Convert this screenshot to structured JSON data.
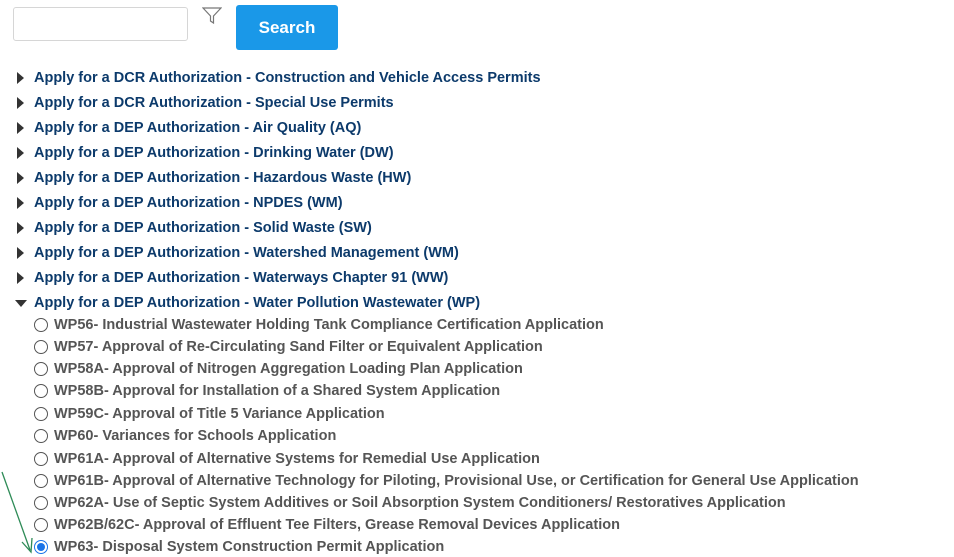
{
  "search": {
    "placeholder": "",
    "value": "",
    "button_label": "Search"
  },
  "icons": {
    "filter": "filter-icon",
    "expand": "triangle-right-icon",
    "collapse": "triangle-down-icon"
  },
  "categories": [
    {
      "label": "Apply for a DCR Authorization - Construction and Vehicle Access Permits",
      "expanded": false
    },
    {
      "label": "Apply for a DCR Authorization - Special Use Permits",
      "expanded": false
    },
    {
      "label": "Apply for a DEP Authorization - Air Quality (AQ)",
      "expanded": false
    },
    {
      "label": "Apply for a DEP Authorization - Drinking Water (DW)",
      "expanded": false
    },
    {
      "label": "Apply for a DEP Authorization - Hazardous Waste (HW)",
      "expanded": false
    },
    {
      "label": "Apply for a DEP Authorization - NPDES (WM)",
      "expanded": false
    },
    {
      "label": "Apply for a DEP Authorization - Solid Waste (SW)",
      "expanded": false
    },
    {
      "label": "Apply for a DEP Authorization - Watershed Management (WM)",
      "expanded": false
    },
    {
      "label": "Apply for a DEP Authorization - Waterways Chapter 91 (WW)",
      "expanded": false
    },
    {
      "label": "Apply for a DEP Authorization - Water Pollution Wastewater (WP)",
      "expanded": true
    }
  ],
  "options": [
    {
      "code": "WP56",
      "title": " - Industrial Wastewater Holding Tank Compliance Certification Application",
      "selected": false
    },
    {
      "code": "WP57",
      "title": " - Approval of Re-Circulating Sand Filter or Equivalent Application",
      "selected": false
    },
    {
      "code": "WP58A",
      "title": " - Approval of Nitrogen Aggregation Loading Plan Application",
      "selected": false
    },
    {
      "code": "WP58B",
      "title": " - Approval for Installation of a Shared System Application",
      "selected": false
    },
    {
      "code": "WP59C",
      "title": " - Approval of Title 5 Variance Application",
      "selected": false
    },
    {
      "code": "WP60",
      "title": " - Variances for Schools Application",
      "selected": false
    },
    {
      "code": "WP61A",
      "title": " - Approval of Alternative Systems for Remedial Use Application",
      "selected": false
    },
    {
      "code": "WP61B",
      "title": " - Approval of Alternative Technology for Piloting, Provisional Use, or Certification for General Use Application",
      "selected": false
    },
    {
      "code": "WP62A",
      "title": " - Use of Septic System Additives or Soil Absorption System Conditioners/ Restoratives Application",
      "selected": false
    },
    {
      "code": "WP62B/62C",
      "title": " - Approval of Effluent Tee Filters, Grease Removal Devices Application",
      "selected": false
    },
    {
      "code": "WP63",
      "title": " - Disposal System Construction Permit Application",
      "selected": true
    }
  ],
  "colors": {
    "accent": "#1a98e8",
    "link": "#0c3a6b",
    "option_text": "#555555",
    "annotation_arrow": "#2e8b57"
  }
}
